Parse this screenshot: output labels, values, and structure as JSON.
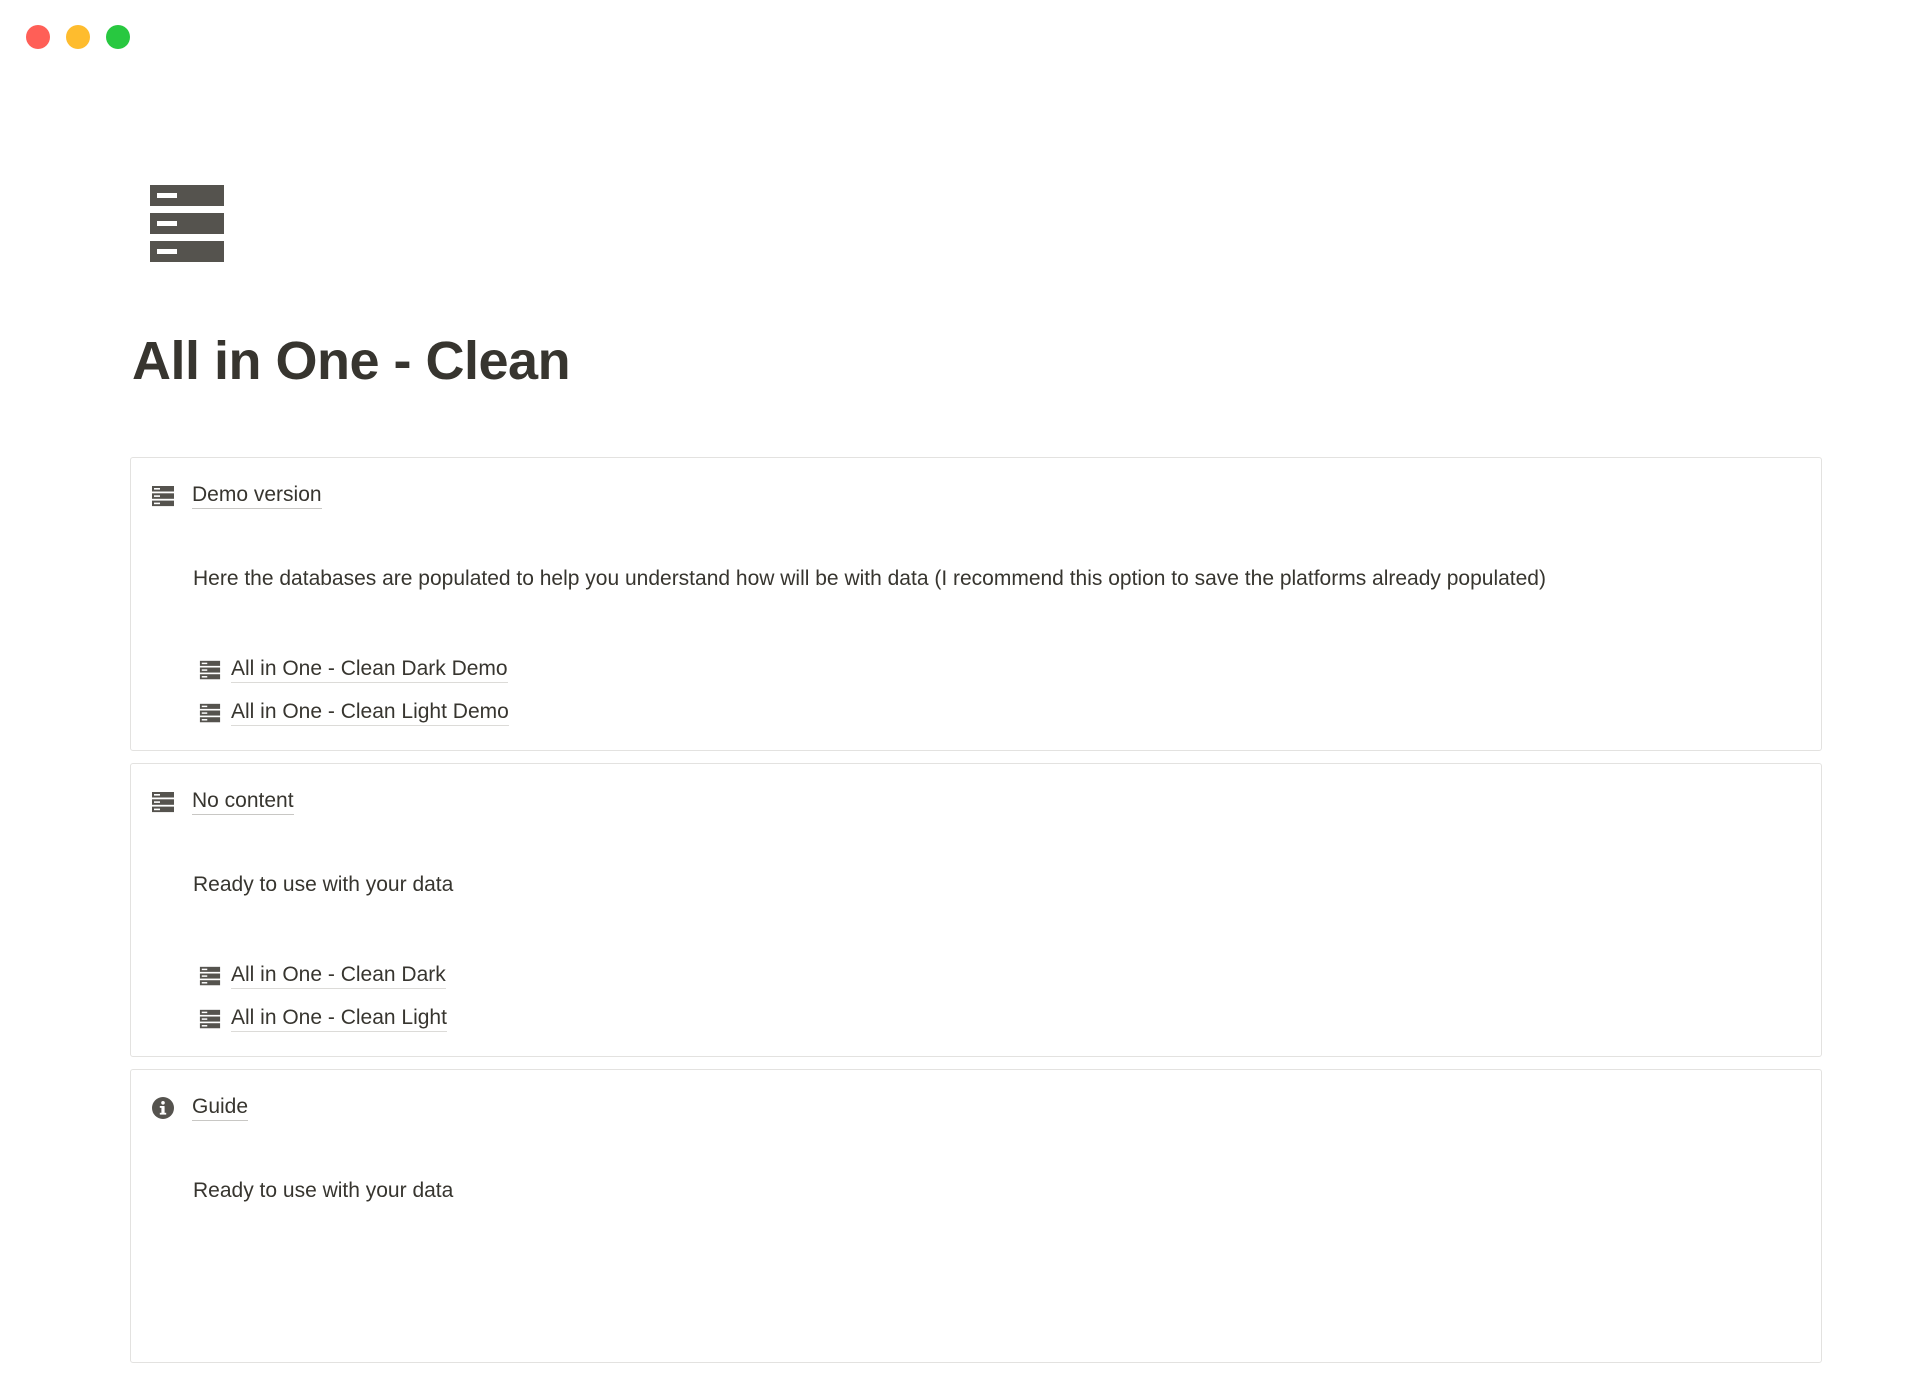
{
  "window": {
    "controls": [
      "close",
      "minimize",
      "zoom"
    ]
  },
  "page": {
    "icon": "database-icon",
    "title": "All in One - Clean"
  },
  "callouts": [
    {
      "icon": "database-icon",
      "title": "Demo version",
      "description": "Here the databases are populated to help you understand how will be with data (I recommend this option to save the platforms already populated)",
      "links": [
        {
          "icon": "database-icon",
          "label": "All in One - Clean Dark Demo"
        },
        {
          "icon": "database-icon",
          "label": "All in One - Clean Light Demo"
        }
      ]
    },
    {
      "icon": "database-icon",
      "title": "No content",
      "description": "Ready to use with your data",
      "links": [
        {
          "icon": "database-icon",
          "label": "All in One - Clean Dark"
        },
        {
          "icon": "database-icon",
          "label": "All in One - Clean Light"
        }
      ]
    },
    {
      "icon": "info-icon",
      "title": "Guide",
      "description": "Ready to use with your data",
      "links": []
    }
  ],
  "colors": {
    "text": "#37352f",
    "icon": "#55534e",
    "border": "#e3e2e0",
    "close": "#ff5f57",
    "minimize": "#febc2e",
    "zoom": "#28c840"
  }
}
